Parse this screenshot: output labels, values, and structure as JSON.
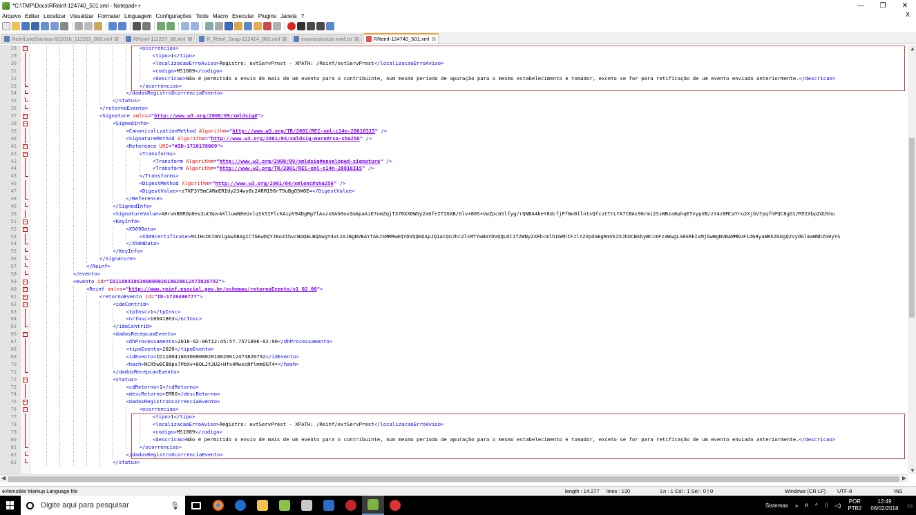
{
  "window": {
    "title": "*C:\\TMP\\Docs\\RReinf-124740_501.xml - Notepad++",
    "minimize": "—",
    "restore": "❐",
    "close": "✕",
    "doc_close": "X"
  },
  "menu": [
    "Arquivo",
    "Editar",
    "Localizar",
    "Visualizar",
    "Formatar",
    "Linguagem",
    "Configurações",
    "Tools",
    "Macro",
    "Executar",
    "Plugins",
    "Janela",
    "?"
  ],
  "tabs": [
    {
      "label": "ReinfLoteEventos-622018_111253_860.xml",
      "active": false
    },
    {
      "label": "RReinf-111257_88.xml",
      "active": false
    },
    {
      "label": "R_Reinf_Soap-112414_882.xml",
      "active": false
    },
    {
      "label": "inconsistencia reinf.txt",
      "active": false
    },
    {
      "label": "RReinf-124740_501.xml",
      "active": true
    }
  ],
  "editor": {
    "lines": [
      {
        "n": "28",
        "i": 8,
        "f": "open",
        "h": [
          [
            "t",
            "<ocorrencias>"
          ]
        ]
      },
      {
        "n": "29",
        "i": 9,
        "f": "line",
        "h": [
          [
            "t",
            "<tipo>"
          ],
          [
            "x",
            "1"
          ],
          [
            "t",
            "</tipo>"
          ]
        ]
      },
      {
        "n": "30",
        "i": 9,
        "f": "line",
        "h": [
          [
            "t",
            "<localizacaoErroAviso>"
          ],
          [
            "x",
            "Registro: evtServPrest - XPATH: /Reinf/evtServPrest"
          ],
          [
            "t",
            "</localizacaoErroAviso>"
          ]
        ]
      },
      {
        "n": "31",
        "i": 9,
        "f": "line",
        "h": [
          [
            "t",
            "<codigo>"
          ],
          [
            "x",
            "MS1089"
          ],
          [
            "t",
            "</codigo>"
          ]
        ]
      },
      {
        "n": "32",
        "i": 9,
        "f": "line",
        "h": [
          [
            "t",
            "<descricao>"
          ],
          [
            "x",
            "Não é permitido o envio de mais de um evento para o contribuinte, num mesmo período de apuração para o mesmo estabelecimento e tomador, exceto se for para retificação de um evento enviado anteriormente."
          ],
          [
            "t",
            "</descricao>"
          ]
        ]
      },
      {
        "n": "33",
        "i": 8,
        "f": "end",
        "h": [
          [
            "t",
            "</ocorrencias>"
          ]
        ]
      },
      {
        "n": "34",
        "i": 7,
        "f": "end",
        "h": [
          [
            "t",
            "</dadosRegistroOcorrenciaEvento>"
          ]
        ]
      },
      {
        "n": "35",
        "i": 6,
        "f": "end",
        "h": [
          [
            "t",
            "</status>"
          ]
        ]
      },
      {
        "n": "36",
        "i": 5,
        "f": "end",
        "h": [
          [
            "t",
            "</retornoEvento>"
          ]
        ]
      },
      {
        "n": "37",
        "i": 5,
        "f": "open",
        "h": [
          [
            "t",
            "<Signature "
          ],
          [
            "a",
            "xmlns"
          ],
          [
            "t",
            "="
          ],
          [
            "v",
            "\""
          ],
          [
            "u",
            "http://www.w3.org/2000/09/xmldsig#"
          ],
          [
            "v",
            "\""
          ],
          [
            "t",
            ">"
          ]
        ]
      },
      {
        "n": "38",
        "i": 6,
        "f": "open",
        "h": [
          [
            "t",
            "<SignedInfo>"
          ]
        ]
      },
      {
        "n": "39",
        "i": 7,
        "f": "line",
        "h": [
          [
            "t",
            "<CanonicalizationMethod "
          ],
          [
            "a",
            "Algorithm"
          ],
          [
            "t",
            "="
          ],
          [
            "v",
            "\""
          ],
          [
            "u",
            "http://www.w3.org/TR/2001/REC-xml-c14n-20010315"
          ],
          [
            "v",
            "\""
          ],
          [
            "t",
            " />"
          ]
        ]
      },
      {
        "n": "40",
        "i": 7,
        "f": "line",
        "h": [
          [
            "t",
            "<SignatureMethod "
          ],
          [
            "a",
            "Algorithm"
          ],
          [
            "t",
            "="
          ],
          [
            "v",
            "\""
          ],
          [
            "u",
            "http://www.w3.org/2001/04/xmldsig-more#rsa-sha256"
          ],
          [
            "v",
            "\""
          ],
          [
            "t",
            " />"
          ]
        ]
      },
      {
        "n": "41",
        "i": 7,
        "f": "open",
        "h": [
          [
            "t",
            "<Reference "
          ],
          [
            "a",
            "URI"
          ],
          [
            "t",
            "="
          ],
          [
            "v",
            "\"#ID-1720178009\""
          ],
          [
            "t",
            ">"
          ]
        ]
      },
      {
        "n": "42",
        "i": 8,
        "f": "open",
        "h": [
          [
            "t",
            "<Transforms>"
          ]
        ]
      },
      {
        "n": "43",
        "i": 9,
        "f": "line",
        "h": [
          [
            "t",
            "<Transform "
          ],
          [
            "a",
            "Algorithm"
          ],
          [
            "t",
            "="
          ],
          [
            "v",
            "\""
          ],
          [
            "u",
            "http://www.w3.org/2000/09/xmldsig#enveloped-signature"
          ],
          [
            "v",
            "\""
          ],
          [
            "t",
            " />"
          ]
        ]
      },
      {
        "n": "44",
        "i": 9,
        "f": "line",
        "h": [
          [
            "t",
            "<Transform "
          ],
          [
            "a",
            "Algorithm"
          ],
          [
            "t",
            "="
          ],
          [
            "v",
            "\""
          ],
          [
            "u",
            "http://www.w3.org/TR/2001/REC-xml-c14n-20010315"
          ],
          [
            "v",
            "\""
          ],
          [
            "t",
            " />"
          ]
        ]
      },
      {
        "n": "45",
        "i": 8,
        "f": "end",
        "h": [
          [
            "t",
            "</Transforms>"
          ]
        ]
      },
      {
        "n": "46",
        "i": 8,
        "f": "line",
        "h": [
          [
            "t",
            "<DigestMethod "
          ],
          [
            "a",
            "Algorithm"
          ],
          [
            "t",
            "="
          ],
          [
            "v",
            "\""
          ],
          [
            "u",
            "http://www.w3.org/2001/04/xmlenc#sha256"
          ],
          [
            "v",
            "\""
          ],
          [
            "t",
            " />"
          ]
        ]
      },
      {
        "n": "47",
        "i": 8,
        "f": "line",
        "h": [
          [
            "t",
            "<DigestValue>"
          ],
          [
            "x",
            "rz7KF3Y9mCARmERIdy234wy8c2ARM198rT9uBgO5W0E="
          ],
          [
            "t",
            "</DigestValue>"
          ]
        ]
      },
      {
        "n": "48",
        "i": 7,
        "f": "end",
        "h": [
          [
            "t",
            "</Reference>"
          ]
        ]
      },
      {
        "n": "49",
        "i": 6,
        "f": "end",
        "h": [
          [
            "t",
            "</SignedInfo>"
          ]
        ]
      },
      {
        "n": "50",
        "i": 6,
        "f": "line",
        "h": [
          [
            "t",
            "<SignatureValue>"
          ],
          [
            "x",
            "A8rvmB8ROp0ev2uC6pv4XlluwN8eUxlqSk5IFlcKAipV94DgRg7lAxzx0Ah6ovImApaAiE7omZqjT370XXDWGy2aGfeITIGXB/Glv+80S+VwZpcbSlfyg/rQNBA4keY8dcfjPfNo0llntsQfcutTrLYA7CBAs96rmi2SzWBza8phqETvypVB/zY4z0MCaYru2XjbV7pqfhPQC8gG1/M5IXbpZdUShu"
          ]
        ]
      },
      {
        "n": "51",
        "i": 6,
        "f": "open",
        "h": [
          [
            "t",
            "<KeyInfo>"
          ]
        ]
      },
      {
        "n": "52",
        "i": 7,
        "f": "open",
        "h": [
          [
            "t",
            "<X509Data>"
          ]
        ]
      },
      {
        "n": "53",
        "i": 8,
        "f": "line",
        "h": [
          [
            "t",
            "<X509Certificate>"
          ],
          [
            "x",
            "MIIHcDCCBVigAwIBAgICTGkwDQYJKoZIhvcNAQELBQAwgY4xCzAJBgNVBAYTAkJSMRMwEQYDVQQKDApJQ1AtQnJhc2lsMTYwNAYDVQQLDC1TZWNyZXRhcmlhIGRhIFJlY2VpdGEgRmVkZXJhbCBkbyBCcmFzaWwgLSBSRkIxMjAwBgNVBAMMKUF1dG9yaWRhZGUgQ2VydGlmaWNhZG9yYS"
          ]
        ]
      },
      {
        "n": "54",
        "i": 7,
        "f": "end",
        "h": [
          [
            "t",
            "</X509Data>"
          ]
        ]
      },
      {
        "n": "55",
        "i": 6,
        "f": "end",
        "h": [
          [
            "t",
            "</KeyInfo>"
          ]
        ]
      },
      {
        "n": "56",
        "i": 5,
        "f": "end",
        "h": [
          [
            "t",
            "</Signature>"
          ]
        ]
      },
      {
        "n": "57",
        "i": 4,
        "f": "end",
        "h": [
          [
            "t",
            "</Reinf>"
          ]
        ]
      },
      {
        "n": "58",
        "i": 3,
        "f": "end",
        "h": [
          [
            "t",
            "</evento>"
          ]
        ]
      },
      {
        "n": "59",
        "i": 3,
        "f": "open",
        "h": [
          [
            "t",
            "<evento "
          ],
          [
            "a",
            "id"
          ],
          [
            "t",
            "="
          ],
          [
            "v",
            "\"ID1180418630000002018020612473826792\""
          ],
          [
            "t",
            ">"
          ]
        ]
      },
      {
        "n": "60",
        "i": 4,
        "f": "open",
        "h": [
          [
            "t",
            "<Reinf "
          ],
          [
            "a",
            "xmlns"
          ],
          [
            "t",
            "="
          ],
          [
            "v",
            "\""
          ],
          [
            "u",
            "http://www.reinf.esocial.gov.br/schemas/retornoEvento/v1_02_00"
          ],
          [
            "v",
            "\""
          ],
          [
            "t",
            ">"
          ]
        ]
      },
      {
        "n": "61",
        "i": 5,
        "f": "open",
        "h": [
          [
            "t",
            "<retornoEvento "
          ],
          [
            "a",
            "id"
          ],
          [
            "t",
            "="
          ],
          [
            "v",
            "\"ID-1726490777\""
          ],
          [
            "t",
            ">"
          ]
        ]
      },
      {
        "n": "62",
        "i": 6,
        "f": "open",
        "h": [
          [
            "t",
            "<ideContrib>"
          ]
        ]
      },
      {
        "n": "63",
        "i": 7,
        "f": "line",
        "h": [
          [
            "t",
            "<tpInsc>"
          ],
          [
            "x",
            "1"
          ],
          [
            "t",
            "</tpInsc>"
          ]
        ]
      },
      {
        "n": "64",
        "i": 7,
        "f": "line",
        "h": [
          [
            "t",
            "<nrInsc>"
          ],
          [
            "x",
            "18041863"
          ],
          [
            "t",
            "</nrInsc>"
          ]
        ]
      },
      {
        "n": "65",
        "i": 6,
        "f": "end",
        "h": [
          [
            "t",
            "</ideContrib>"
          ]
        ]
      },
      {
        "n": "66",
        "i": 6,
        "f": "open",
        "h": [
          [
            "t",
            "<dadosRecepcaoEvento>"
          ]
        ]
      },
      {
        "n": "67",
        "i": 7,
        "f": "line",
        "h": [
          [
            "t",
            "<dhProcessamento>"
          ],
          [
            "x",
            "2018-02-06T12:45:57.7571896-02:00"
          ],
          [
            "t",
            "</dhProcessamento>"
          ]
        ]
      },
      {
        "n": "68",
        "i": 7,
        "f": "line",
        "h": [
          [
            "t",
            "<tipoEvento>"
          ],
          [
            "x",
            "2020"
          ],
          [
            "t",
            "</tipoEvento>"
          ]
        ]
      },
      {
        "n": "69",
        "i": 7,
        "f": "line",
        "h": [
          [
            "t",
            "<idEvento>"
          ],
          [
            "x",
            "ID1180418630000002018020612473826792"
          ],
          [
            "t",
            "</idEvento>"
          ]
        ]
      },
      {
        "n": "70",
        "i": 7,
        "f": "line",
        "h": [
          [
            "t",
            "<hash>"
          ],
          [
            "x",
            "NCR5w0CB8ps7PbXv+8OLJt3U2+Hfx4MwscNflmmOGT4="
          ],
          [
            "t",
            "</hash>"
          ]
        ]
      },
      {
        "n": "71",
        "i": 6,
        "f": "end",
        "h": [
          [
            "t",
            "</dadosRecepcaoEvento>"
          ]
        ]
      },
      {
        "n": "72",
        "i": 6,
        "f": "open",
        "h": [
          [
            "t",
            "<status>"
          ]
        ]
      },
      {
        "n": "73",
        "i": 7,
        "f": "line",
        "h": [
          [
            "t",
            "<cdRetorno>"
          ],
          [
            "x",
            "1"
          ],
          [
            "t",
            "</cdRetorno>"
          ]
        ]
      },
      {
        "n": "74",
        "i": 7,
        "f": "line",
        "h": [
          [
            "t",
            "<descRetorno>"
          ],
          [
            "x",
            "ERRO"
          ],
          [
            "t",
            "</descRetorno>"
          ]
        ]
      },
      {
        "n": "75",
        "i": 7,
        "f": "open",
        "h": [
          [
            "t",
            "<dadosRegistroOcorrenciaEvento>"
          ]
        ]
      },
      {
        "n": "76",
        "i": 8,
        "f": "open",
        "h": [
          [
            "t",
            "<ocorrencias>"
          ]
        ]
      },
      {
        "n": "77",
        "i": 9,
        "f": "line",
        "h": [
          [
            "t",
            "<tipo>"
          ],
          [
            "x",
            "1"
          ],
          [
            "t",
            "</tipo>"
          ]
        ]
      },
      {
        "n": "78",
        "i": 9,
        "f": "line",
        "h": [
          [
            "t",
            "<localizacaoErroAviso>"
          ],
          [
            "x",
            "Registro: evtServPrest - XPATH: /Reinf/evtServPrest"
          ],
          [
            "t",
            "</localizacaoErroAviso>"
          ]
        ]
      },
      {
        "n": "79",
        "i": 9,
        "f": "line",
        "h": [
          [
            "t",
            "<codigo>"
          ],
          [
            "x",
            "MS1089"
          ],
          [
            "t",
            "</codigo>"
          ]
        ]
      },
      {
        "n": "80",
        "i": 9,
        "f": "line",
        "h": [
          [
            "t",
            "<descricao>"
          ],
          [
            "x",
            "Não é permitido o envio de mais de um evento para o contribuinte, num mesmo período de apuração para o mesmo estabelecimento e tomador, exceto se for para retificação de um evento enviado anteriormente."
          ],
          [
            "t",
            "</descricao>"
          ]
        ]
      },
      {
        "n": "81",
        "i": 8,
        "f": "end",
        "h": [
          [
            "t",
            "</ocorrencias>"
          ]
        ]
      },
      {
        "n": "82",
        "i": 7,
        "f": "end",
        "h": [
          [
            "t",
            "</dadosRegistroOcorrenciaEvento>"
          ]
        ]
      },
      {
        "n": "83",
        "i": 6,
        "f": "end",
        "h": [
          [
            "t",
            "</status>"
          ]
        ]
      }
    ]
  },
  "statusbar": {
    "filetype": "eXtensible Markup Language file",
    "length": "length : 14.277",
    "lines": "lines : 130",
    "position": "Ln : 1   Col : 1   Sel : 0 | 0",
    "eol": "Windows (CR LF)",
    "encoding": "UTF-8",
    "mode": "INS"
  },
  "taskbar": {
    "search_placeholder": "Digite aqui para pesquisar",
    "tray_label": "Sistemas",
    "lang1": "POR",
    "lang2": "PTB2",
    "time": "12:49",
    "date": "06/02/2018"
  },
  "colors": {
    "tag": "#0000ff",
    "attr": "#ff0000",
    "value": "#8000ff",
    "accent": "#f39c34"
  }
}
